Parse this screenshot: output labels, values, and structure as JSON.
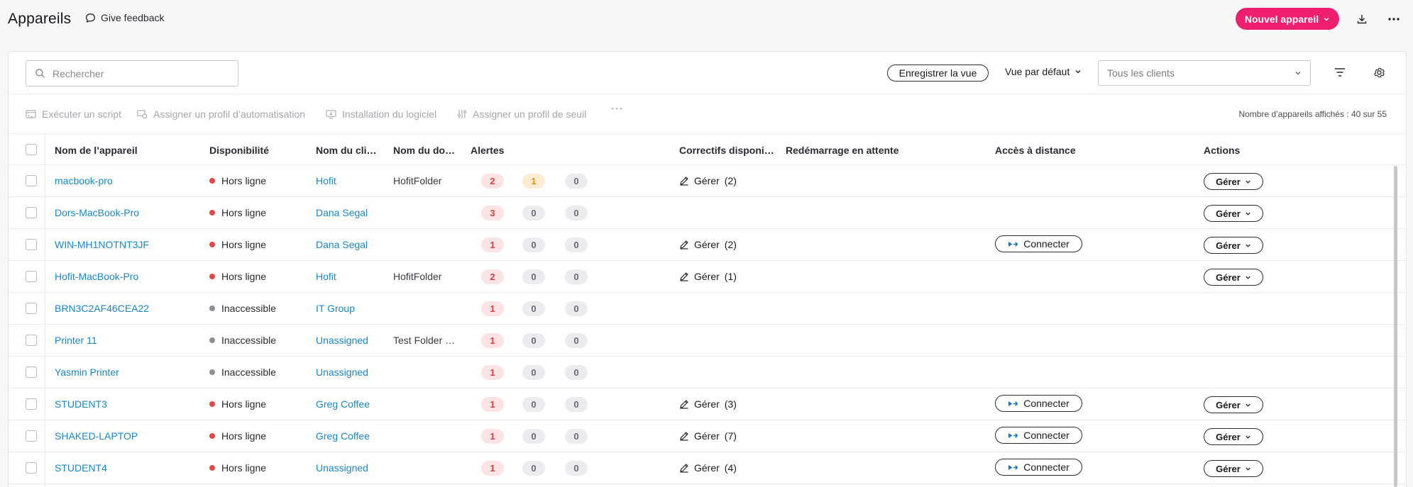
{
  "header": {
    "title": "Appareils",
    "feedback_label": "Give feedback",
    "new_device_label": "Nouvel appareil",
    "accent_color": "#ee1f6e"
  },
  "toolbar": {
    "search_placeholder": "Rechercher",
    "save_view_label": "Enregistrer la vue",
    "view_label": "Vue par défaut",
    "clients_placeholder": "Tous les clients"
  },
  "actions": {
    "run_script": "Exécuter un script",
    "assign_automation": "Assigner un profil d’automatisation",
    "install_software": "Installation du logiciel",
    "assign_threshold": "Assigner un profil de seuil",
    "count_text": "Nombre d’appareils affichés : 40 sur 55"
  },
  "columns": {
    "name": "Nom de l’appareil",
    "availability": "Disponibilité",
    "client": "Nom du cli…",
    "domain": "Nom du do…",
    "alerts": "Alertes",
    "patches": "Correctifs disponi…",
    "reboot": "Redémarrage en attente",
    "remote": "Accès à distance",
    "actions": "Actions"
  },
  "labels": {
    "manage": "Gérer",
    "connect": "Connecter"
  },
  "status_colors": {
    "offline": "#e34848",
    "unreachable": "#8e8e95"
  },
  "rows": [
    {
      "name": "macbook-pro",
      "status": "Hors ligne",
      "status_type": "offline",
      "client": "Hofit",
      "domain": "HofitFolder",
      "alerts": [
        "2",
        "1",
        "0"
      ],
      "patch_count": "(2)",
      "connect": false,
      "manage": true
    },
    {
      "name": "Dors-MacBook-Pro",
      "status": "Hors ligne",
      "status_type": "offline",
      "client": "Dana Segal",
      "domain": "",
      "alerts": [
        "3",
        "0",
        "0"
      ],
      "patch_count": "",
      "connect": false,
      "manage": true
    },
    {
      "name": "WIN-MH1NOTNT3JF",
      "status": "Hors ligne",
      "status_type": "offline",
      "client": "Dana Segal",
      "domain": "",
      "alerts": [
        "1",
        "0",
        "0"
      ],
      "patch_count": "(2)",
      "connect": true,
      "manage": true
    },
    {
      "name": "Hofit-MacBook-Pro",
      "status": "Hors ligne",
      "status_type": "offline",
      "client": "Hofit",
      "domain": "HofitFolder",
      "alerts": [
        "2",
        "0",
        "0"
      ],
      "patch_count": "(1)",
      "connect": false,
      "manage": true
    },
    {
      "name": "BRN3C2AF46CEA22",
      "status": "Inaccessible",
      "status_type": "unreachable",
      "client": "IT Group",
      "domain": "",
      "alerts": [
        "1",
        "0",
        "0"
      ],
      "patch_count": "",
      "connect": false,
      "manage": false
    },
    {
      "name": "Printer 11",
      "status": "Inaccessible",
      "status_type": "unreachable",
      "client": "Unassigned",
      "domain": "Test Folder …",
      "alerts": [
        "1",
        "0",
        "0"
      ],
      "patch_count": "",
      "connect": false,
      "manage": false
    },
    {
      "name": "Yasmin Printer",
      "status": "Inaccessible",
      "status_type": "unreachable",
      "client": "Unassigned",
      "domain": "",
      "alerts": [
        "1",
        "0",
        "0"
      ],
      "patch_count": "",
      "connect": false,
      "manage": false
    },
    {
      "name": "STUDENT3",
      "status": "Hors ligne",
      "status_type": "offline",
      "client": "Greg Coffee",
      "domain": "",
      "alerts": [
        "1",
        "0",
        "0"
      ],
      "patch_count": "(3)",
      "connect": true,
      "manage": true
    },
    {
      "name": "SHAKED-LAPTOP",
      "status": "Hors ligne",
      "status_type": "offline",
      "client": "Greg Coffee",
      "domain": "",
      "alerts": [
        "1",
        "0",
        "0"
      ],
      "patch_count": "(7)",
      "connect": true,
      "manage": true
    },
    {
      "name": "STUDENT4",
      "status": "Hors ligne",
      "status_type": "offline",
      "client": "Unassigned",
      "domain": "",
      "alerts": [
        "1",
        "0",
        "0"
      ],
      "patch_count": "(4)",
      "connect": true,
      "manage": true
    }
  ]
}
